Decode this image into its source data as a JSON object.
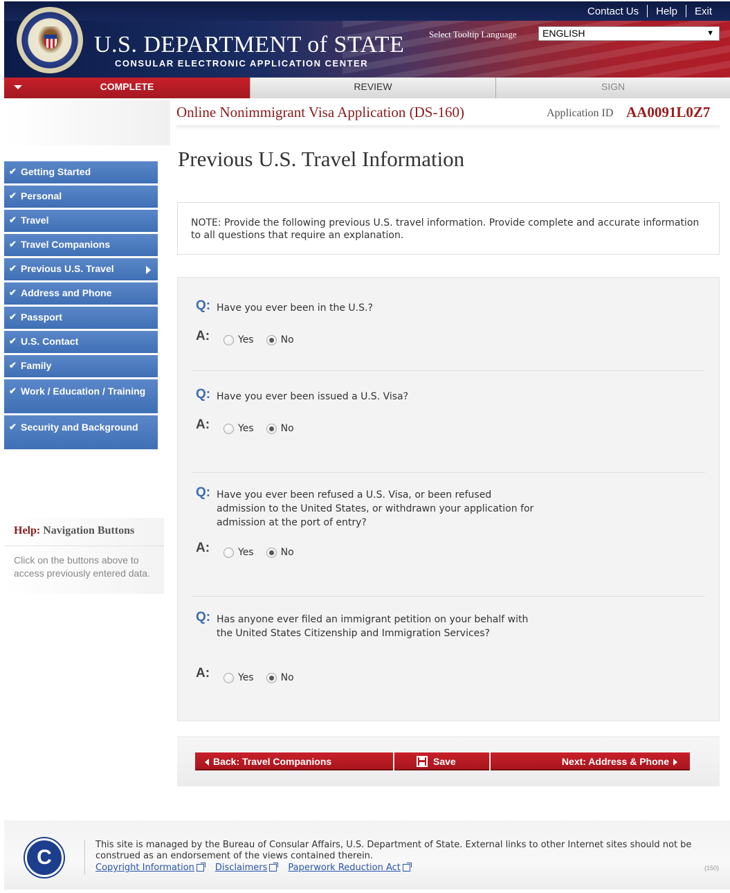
{
  "header": {
    "dept_title": "U.S. DEPARTMENT of STATE",
    "dept_subtitle": "CONSULAR ELECTRONIC APPLICATION CENTER",
    "top_links": [
      "Contact Us",
      "Help",
      "Exit"
    ],
    "language_label": "Select Tooltip Language",
    "language_value": "ENGLISH",
    "seal_icon": "dept-of-state-seal"
  },
  "tabs": [
    {
      "label": "COMPLETE",
      "state": "active"
    },
    {
      "label": "REVIEW",
      "state": "available"
    },
    {
      "label": "SIGN",
      "state": "disabled"
    }
  ],
  "app": {
    "title": "Online Nonimmigrant Visa Application (DS-160)",
    "id_label": "Application ID",
    "id_value": "AA0091L0Z7"
  },
  "page_heading": "Previous U.S. Travel Information",
  "sidebar": {
    "items": [
      {
        "label": "Getting Started",
        "done": true
      },
      {
        "label": "Personal",
        "done": true
      },
      {
        "label": "Travel",
        "done": true
      },
      {
        "label": "Travel Companions",
        "done": true
      },
      {
        "label": "Previous U.S. Travel",
        "done": true,
        "current": true
      },
      {
        "label": "Address and Phone",
        "done": true
      },
      {
        "label": "Passport",
        "done": true
      },
      {
        "label": "U.S. Contact",
        "done": true
      },
      {
        "label": "Family",
        "done": true
      },
      {
        "label": "Work / Education / Training",
        "done": true
      },
      {
        "label": "Security and Background",
        "done": true
      }
    ]
  },
  "help": {
    "prefix": "Help:",
    "topic": "Navigation Buttons",
    "text": "Click on the buttons above to access previously entered data."
  },
  "note": "NOTE: Provide the following previous U.S. travel information. Provide complete and accurate information to all questions that require an explanation.",
  "questions": [
    {
      "q_label": "Q:",
      "a_label": "A:",
      "text": "Have you ever been in the U.S.?",
      "options": [
        "Yes",
        "No"
      ],
      "selected": "No"
    },
    {
      "q_label": "Q:",
      "a_label": "A:",
      "text": "Have you ever been issued a U.S. Visa?",
      "options": [
        "Yes",
        "No"
      ],
      "selected": "No"
    },
    {
      "q_label": "Q:",
      "a_label": "A:",
      "text": "Have you ever been refused a U.S. Visa, or been refused admission to the United States, or withdrawn your application for admission at the port of entry?",
      "options": [
        "Yes",
        "No"
      ],
      "selected": "No"
    },
    {
      "q_label": "Q:",
      "a_label": "A:",
      "text": "Has anyone ever filed an immigrant petition on your behalf with the United States Citizenship and Immigration Services?",
      "options": [
        "Yes",
        "No"
      ],
      "selected": "No"
    }
  ],
  "buttons": {
    "back": "Back: Travel Companions",
    "save": "Save",
    "next": "Next: Address & Phone"
  },
  "footer": {
    "text": "This site is managed by the Bureau of Consular Affairs, U.S. Department of State. External links to other Internet sites should not be construed as an endorsement of the views contained therein.",
    "links": [
      "Copyright Information",
      "Disclaimers",
      "Paperwork Reduction Act"
    ],
    "code": "(150)",
    "logo_letter": "C"
  },
  "colors": {
    "brand_red": "#b01c28",
    "nav_blue": "#4a78bd",
    "navy": "#0d1a45"
  }
}
